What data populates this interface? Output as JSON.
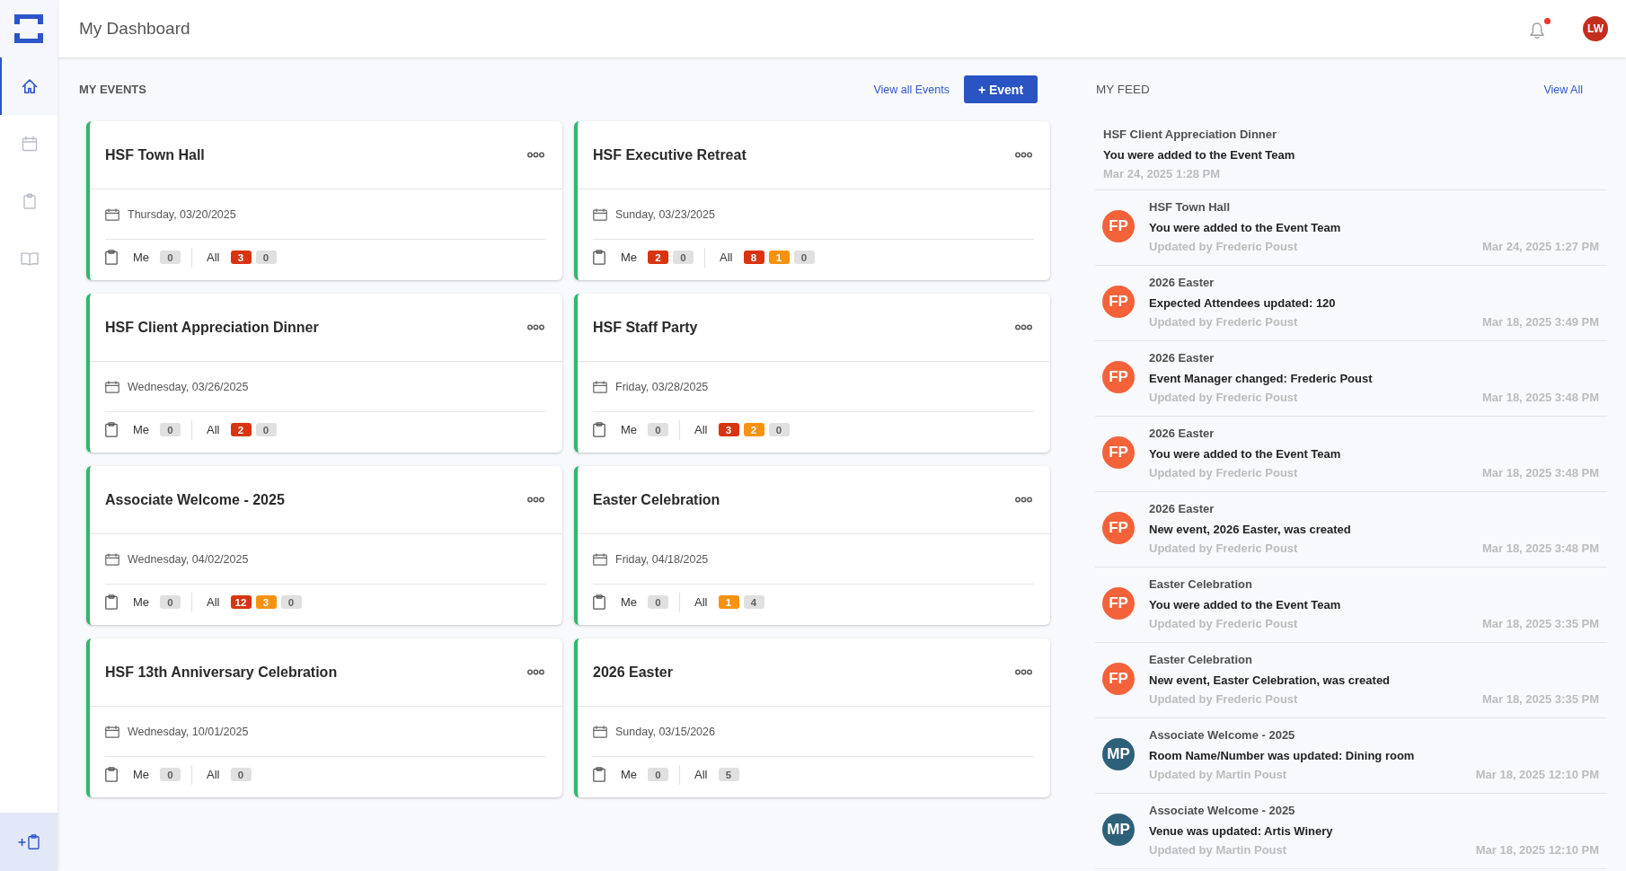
{
  "sidebar": {
    "items": [
      {
        "kind": "home",
        "selected": true
      },
      {
        "kind": "calendar",
        "selected": false
      },
      {
        "kind": "tasks",
        "selected": false
      },
      {
        "kind": "book",
        "selected": false
      }
    ]
  },
  "header": {
    "title": "My Dashboard",
    "notifications": {
      "unread": true
    },
    "user": {
      "initials": "LW"
    }
  },
  "events": {
    "heading": "MY EVENTS",
    "view_all": "View all Events",
    "add_button": "+ Event",
    "items": [
      {
        "title": "HSF Town Hall",
        "date": "Thursday, 03/20/2025",
        "task_groups": [
          {
            "label": "Me",
            "badges": [
              {
                "count": "0",
                "color": "#e0e0e0"
              }
            ]
          },
          {
            "label": "All",
            "badges": [
              {
                "count": "3",
                "color": "#d7340f"
              },
              {
                "count": "0",
                "color": "#e0e0e0"
              }
            ]
          }
        ]
      },
      {
        "title": "HSF Executive Retreat",
        "date": "Sunday, 03/23/2025",
        "task_groups": [
          {
            "label": "Me",
            "badges": [
              {
                "count": "2",
                "color": "#d7340f"
              },
              {
                "count": "0",
                "color": "#e0e0e0"
              }
            ]
          },
          {
            "label": "All",
            "badges": [
              {
                "count": "8",
                "color": "#d7340f"
              },
              {
                "count": "1",
                "color": "#f8920e"
              },
              {
                "count": "0",
                "color": "#e0e0e0"
              }
            ]
          }
        ]
      },
      {
        "title": "HSF Client Appreciation Dinner",
        "date": "Wednesday, 03/26/2025",
        "task_groups": [
          {
            "label": "Me",
            "badges": [
              {
                "count": "0",
                "color": "#e0e0e0"
              }
            ]
          },
          {
            "label": "All",
            "badges": [
              {
                "count": "2",
                "color": "#d7340f"
              },
              {
                "count": "0",
                "color": "#e0e0e0"
              }
            ]
          }
        ]
      },
      {
        "title": "HSF Staff Party",
        "date": "Friday, 03/28/2025",
        "task_groups": [
          {
            "label": "Me",
            "badges": [
              {
                "count": "0",
                "color": "#e0e0e0"
              }
            ]
          },
          {
            "label": "All",
            "badges": [
              {
                "count": "3",
                "color": "#d7340f"
              },
              {
                "count": "2",
                "color": "#f8920e"
              },
              {
                "count": "0",
                "color": "#e0e0e0"
              }
            ]
          }
        ]
      },
      {
        "title": "Associate Welcome - 2025",
        "date": "Wednesday, 04/02/2025",
        "task_groups": [
          {
            "label": "Me",
            "badges": [
              {
                "count": "0",
                "color": "#e0e0e0"
              }
            ]
          },
          {
            "label": "All",
            "badges": [
              {
                "count": "12",
                "color": "#d7340f"
              },
              {
                "count": "3",
                "color": "#f8920e"
              },
              {
                "count": "0",
                "color": "#e0e0e0"
              }
            ]
          }
        ]
      },
      {
        "title": "Easter Celebration",
        "date": "Friday, 04/18/2025",
        "task_groups": [
          {
            "label": "Me",
            "badges": [
              {
                "count": "0",
                "color": "#e0e0e0"
              }
            ]
          },
          {
            "label": "All",
            "badges": [
              {
                "count": "1",
                "color": "#f8920e"
              },
              {
                "count": "4",
                "color": "#e0e0e0"
              }
            ]
          }
        ]
      },
      {
        "title": "HSF 13th Anniversary Celebration",
        "date": "Wednesday, 10/01/2025",
        "task_groups": [
          {
            "label": "Me",
            "badges": [
              {
                "count": "0",
                "color": "#e0e0e0"
              }
            ]
          },
          {
            "label": "All",
            "badges": [
              {
                "count": "0",
                "color": "#e0e0e0"
              }
            ]
          }
        ]
      },
      {
        "title": "2026 Easter",
        "date": "Sunday, 03/15/2026",
        "task_groups": [
          {
            "label": "Me",
            "badges": [
              {
                "count": "0",
                "color": "#e0e0e0"
              }
            ]
          },
          {
            "label": "All",
            "badges": [
              {
                "count": "5",
                "color": "#e0e0e0"
              }
            ]
          }
        ]
      }
    ]
  },
  "feed": {
    "heading": "MY FEED",
    "view_all": "View All",
    "items": [
      {
        "kind": "note",
        "event": "HSF Client Appreciation Dinner",
        "message": "You were added to the Event Team",
        "time": "Mar 24, 2025 1:28 PM"
      },
      {
        "kind": "update",
        "initials": "FP",
        "color": "#f4623a",
        "event": "HSF Town Hall",
        "message": "You were added to the Event Team",
        "updated_by": "Updated by Frederic Poust",
        "time": "Mar 24, 2025 1:27 PM"
      },
      {
        "kind": "update",
        "initials": "FP",
        "color": "#f4623a",
        "event": "2026 Easter",
        "message": "Expected Attendees updated: 120",
        "updated_by": "Updated by Frederic Poust",
        "time": "Mar 18, 2025 3:49 PM"
      },
      {
        "kind": "update",
        "initials": "FP",
        "color": "#f4623a",
        "event": "2026 Easter",
        "message": "Event Manager changed: Frederic Poust",
        "updated_by": "Updated by Frederic Poust",
        "time": "Mar 18, 2025 3:48 PM"
      },
      {
        "kind": "update",
        "initials": "FP",
        "color": "#f4623a",
        "event": "2026 Easter",
        "message": "You were added to the Event Team",
        "updated_by": "Updated by Frederic Poust",
        "time": "Mar 18, 2025 3:48 PM"
      },
      {
        "kind": "update",
        "initials": "FP",
        "color": "#f4623a",
        "event": "2026 Easter",
        "message": "New event, 2026 Easter, was created",
        "updated_by": "Updated by Frederic Poust",
        "time": "Mar 18, 2025 3:48 PM"
      },
      {
        "kind": "update",
        "initials": "FP",
        "color": "#f4623a",
        "event": "Easter Celebration",
        "message": "You were added to the Event Team",
        "updated_by": "Updated by Frederic Poust",
        "time": "Mar 18, 2025 3:35 PM"
      },
      {
        "kind": "update",
        "initials": "FP",
        "color": "#f4623a",
        "event": "Easter Celebration",
        "message": "New event, Easter Celebration, was created",
        "updated_by": "Updated by Frederic Poust",
        "time": "Mar 18, 2025 3:35 PM"
      },
      {
        "kind": "update",
        "initials": "MP",
        "color": "#2e6079",
        "event": "Associate Welcome - 2025",
        "message": "Room Name/Number was updated: Dining room",
        "updated_by": "Updated by Martin Poust",
        "time": "Mar 18, 2025 12:10 PM"
      },
      {
        "kind": "update",
        "initials": "MP",
        "color": "#2e6079",
        "event": "Associate Welcome - 2025",
        "message": "Venue was updated: Artis Winery",
        "updated_by": "Updated by Martin Poust",
        "time": "Mar 18, 2025 12:10 PM"
      }
    ]
  }
}
